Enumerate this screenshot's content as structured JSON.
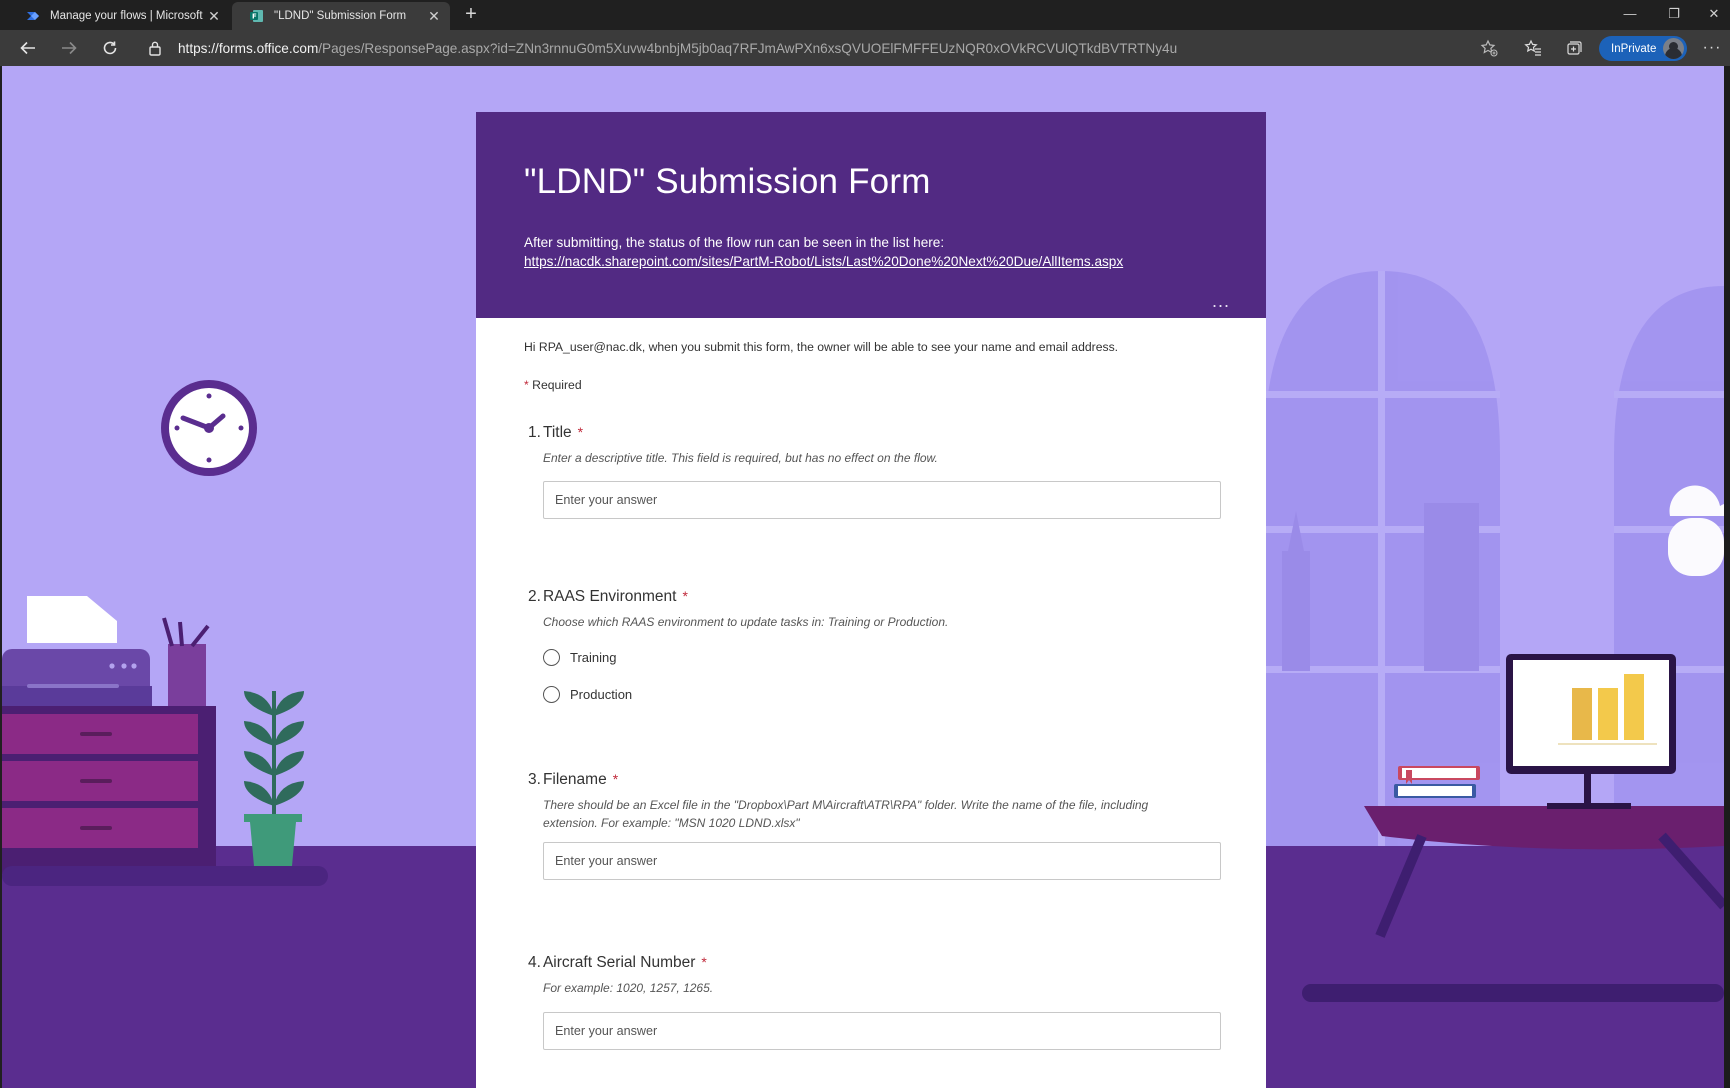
{
  "browser": {
    "tabs": [
      {
        "label": "Manage your flows | Microsoft P",
        "active": false
      },
      {
        "label": "\"LDND\" Submission Form",
        "active": true
      }
    ],
    "url": {
      "scheme": "https://",
      "host": "forms.office.com",
      "path": "/Pages/ResponsePage.aspx?id=ZNn3rnnuG0m5Xuvw4bnbjM5jb0aq7RFJmAwPXn6xsQVUOElFMFFEUzNQR0xOVkRCVUlQTkdBVTRTNy4u"
    },
    "inprivate_label": "InPrivate",
    "accent_color": "#1c62b9"
  },
  "form": {
    "title": "\"LDND\" Submission Form",
    "description": "After submitting, the status of the flow run can be seen in the list here:",
    "link": "https://nacdk.sharepoint.com/sites/PartM-Robot/Lists/Last%20Done%20Next%20Due/AllItems.aspx",
    "more_label": "...",
    "notice": "Hi RPA_user@nac.dk, when you submit this form, the owner will be able to see your name and email address.",
    "required_star": "*",
    "required_label": "Required",
    "header_color": "#522a83",
    "questions": [
      {
        "number": "1.",
        "title": "Title",
        "subtitle": "Enter a descriptive title. This field is required, but has no effect on the flow.",
        "placeholder": "Enter your answer"
      },
      {
        "number": "2.",
        "title": "RAAS Environment",
        "subtitle": "Choose which RAAS environment to update tasks in: Training or Production.",
        "options": [
          "Training",
          "Production"
        ]
      },
      {
        "number": "3.",
        "title": "Filename",
        "subtitle": "There should be an Excel file in the \"Dropbox\\Part M\\Aircraft\\ATR\\RPA\" folder. Write the name of the file, including extension. For example: \"MSN 1020 LDND.xlsx\"",
        "placeholder": "Enter your answer"
      },
      {
        "number": "4.",
        "title": "Aircraft Serial Number",
        "subtitle": "For example: 1020, 1257, 1265.",
        "placeholder": "Enter your answer"
      }
    ]
  }
}
